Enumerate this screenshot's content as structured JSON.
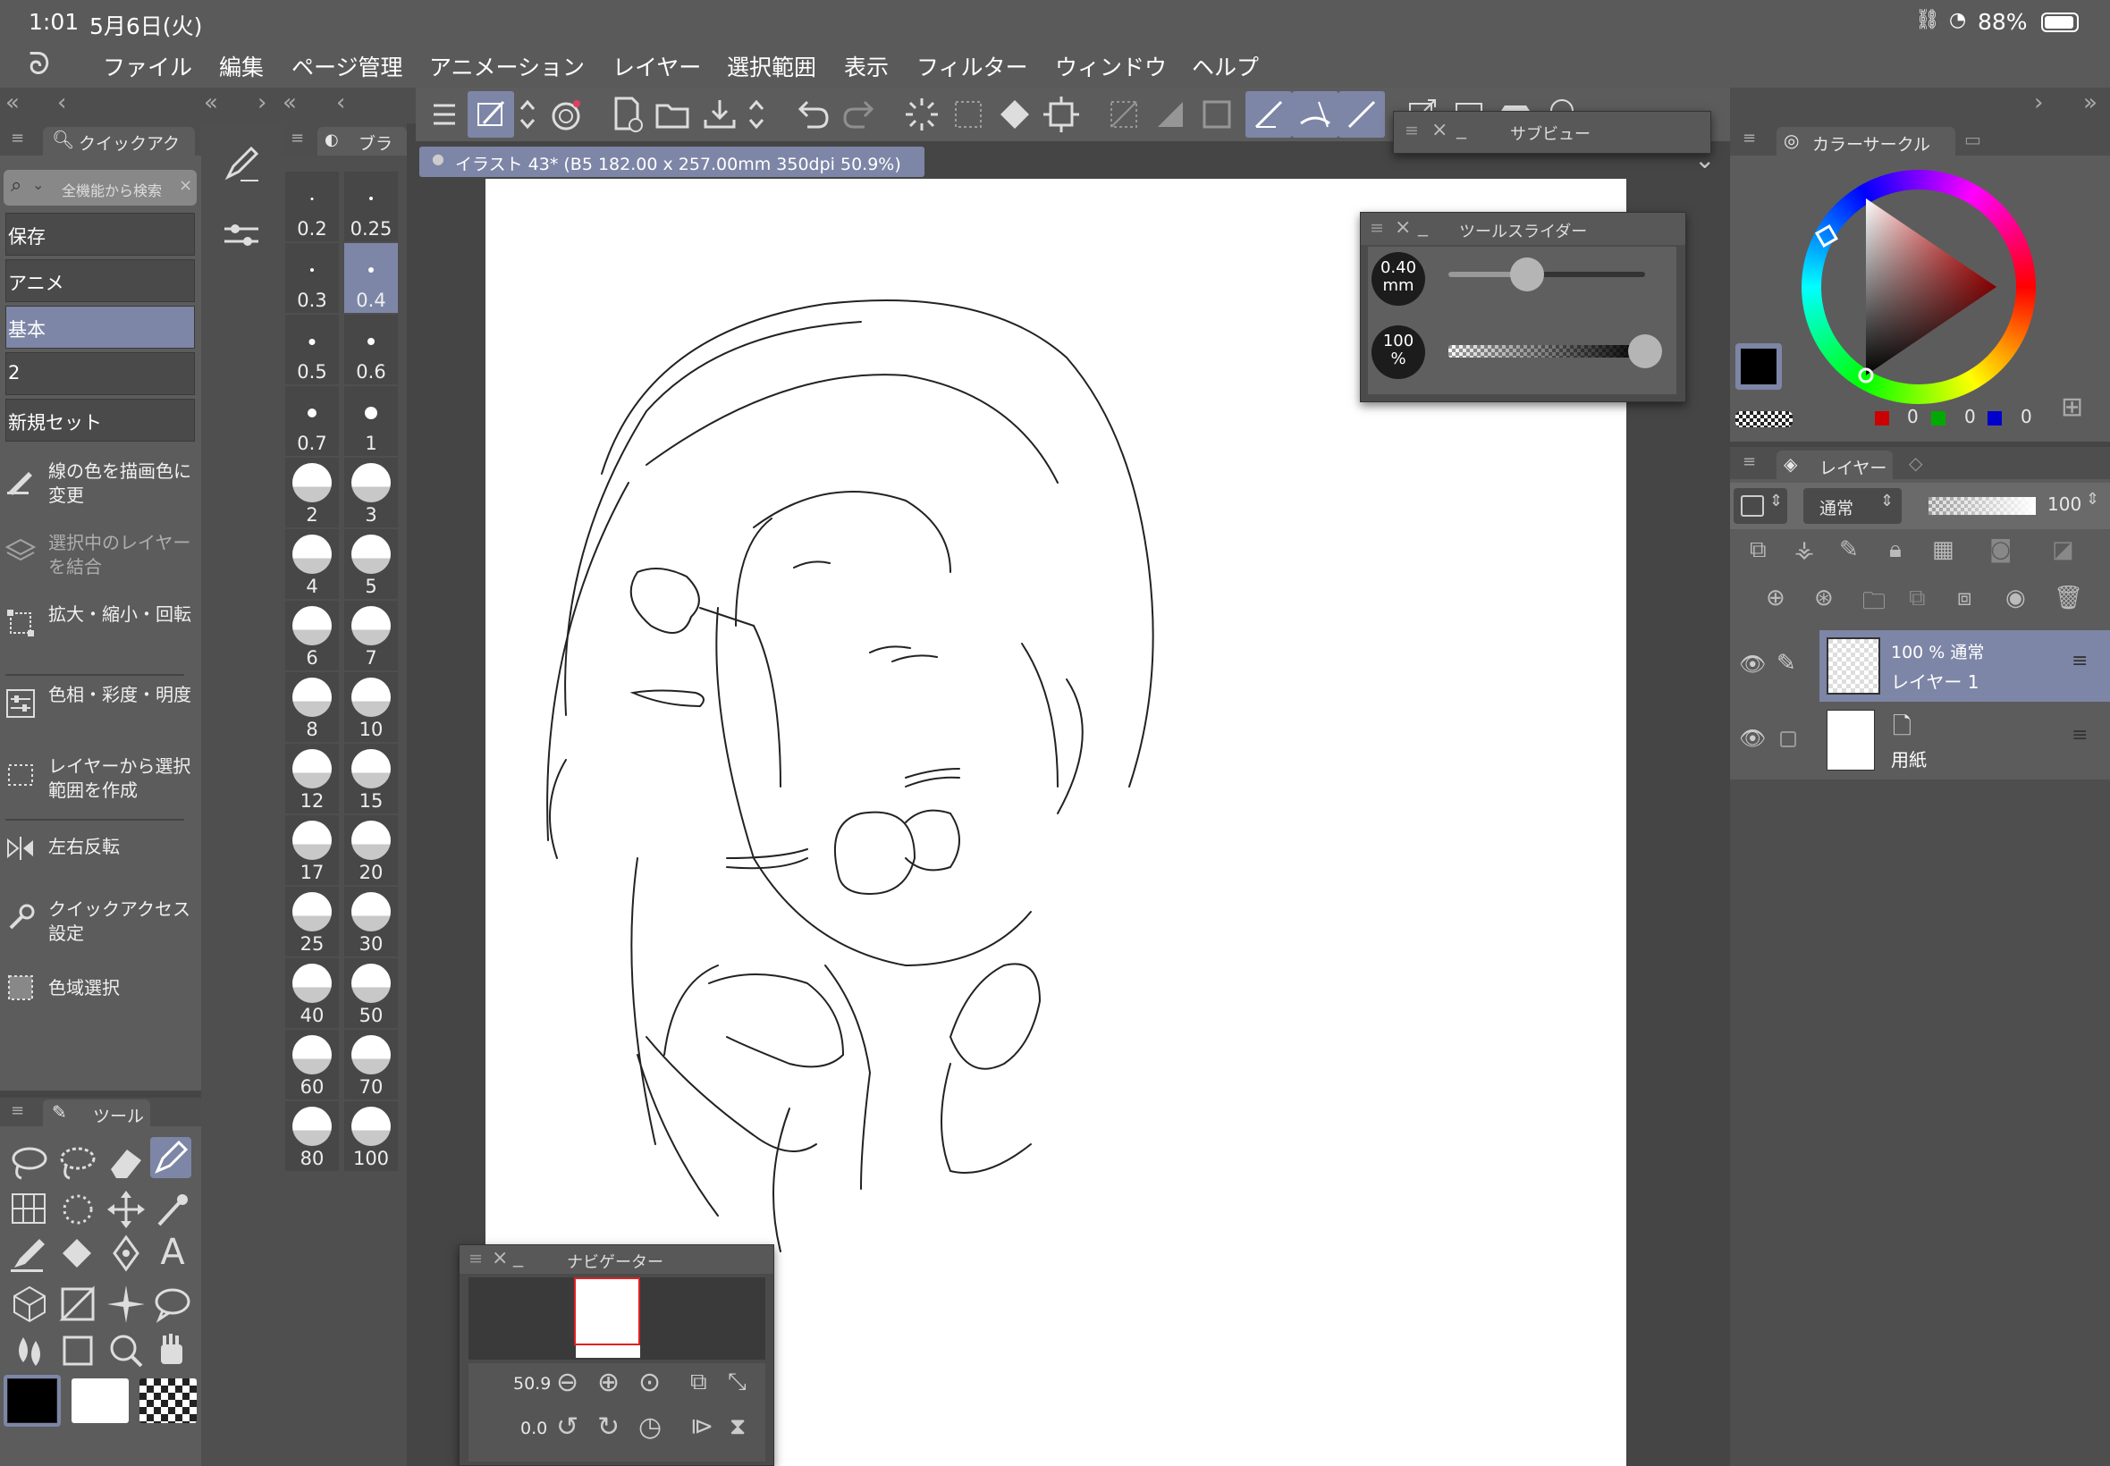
{
  "status": {
    "time": "1:01",
    "date": "5月6日(火)",
    "battery": "88%"
  },
  "menu": [
    "ファイル",
    "編集",
    "ページ管理",
    "アニメーション",
    "レイヤー",
    "選択範囲",
    "表示",
    "フィルター",
    "ウィンドウ",
    "ヘルプ"
  ],
  "quick_access": {
    "tab_label": "クイックアク",
    "search_placeholder": "全機能から検索",
    "sets": [
      "保存",
      "アニメ",
      "基本",
      "2",
      "新規セット"
    ],
    "selected_set": "基本",
    "commands": [
      "線の色を描画色に変更",
      "選択中のレイヤーを結合",
      "拡大・縮小・回転",
      "色相・彩度・明度",
      "レイヤーから選択範囲を作成",
      "左右反転",
      "クイックアクセス設定",
      "色域選択"
    ]
  },
  "tool_panel": {
    "tab_label": "ツール"
  },
  "brush_panel": {
    "tab_label": "ブラ",
    "sizes": [
      "0.2",
      "0.25",
      "0.3",
      "0.4",
      "0.5",
      "0.6",
      "0.7",
      "1",
      "2",
      "3",
      "4",
      "5",
      "6",
      "7",
      "8",
      "10",
      "12",
      "15",
      "17",
      "20",
      "25",
      "30",
      "40",
      "50",
      "60",
      "70",
      "80",
      "100"
    ],
    "selected": "0.4"
  },
  "canvas": {
    "tab_title": "イラスト 43* (B5 182.00 x 257.00mm 350dpi 50.9%)"
  },
  "subview": {
    "title": "サブビュー"
  },
  "tool_slider": {
    "title": "ツールスライダー",
    "size_value": "0.40",
    "size_unit": "mm",
    "opacity_value": "100",
    "opacity_unit": "%",
    "size_fraction": 0.4,
    "opacity_fraction": 1.0
  },
  "navigator": {
    "title": "ナビゲーター",
    "zoom": "50.9",
    "rotation": "0.0"
  },
  "color_circle": {
    "tab_label": "カラーサークル",
    "r": "0",
    "g": "0",
    "b": "0",
    "main_color": "#000000",
    "sub_color": "#ffffff"
  },
  "layers": {
    "tab_label": "レイヤー",
    "blend_mode": "通常",
    "opacity": "100",
    "items": [
      {
        "info": "100 % 通常",
        "name": "レイヤー 1",
        "selected": true
      },
      {
        "info": "",
        "name": "用紙",
        "selected": false
      }
    ]
  },
  "colors": {
    "accent": "#7d86a6",
    "panel": "#5c5c5c",
    "dark": "#3c3c3c"
  }
}
